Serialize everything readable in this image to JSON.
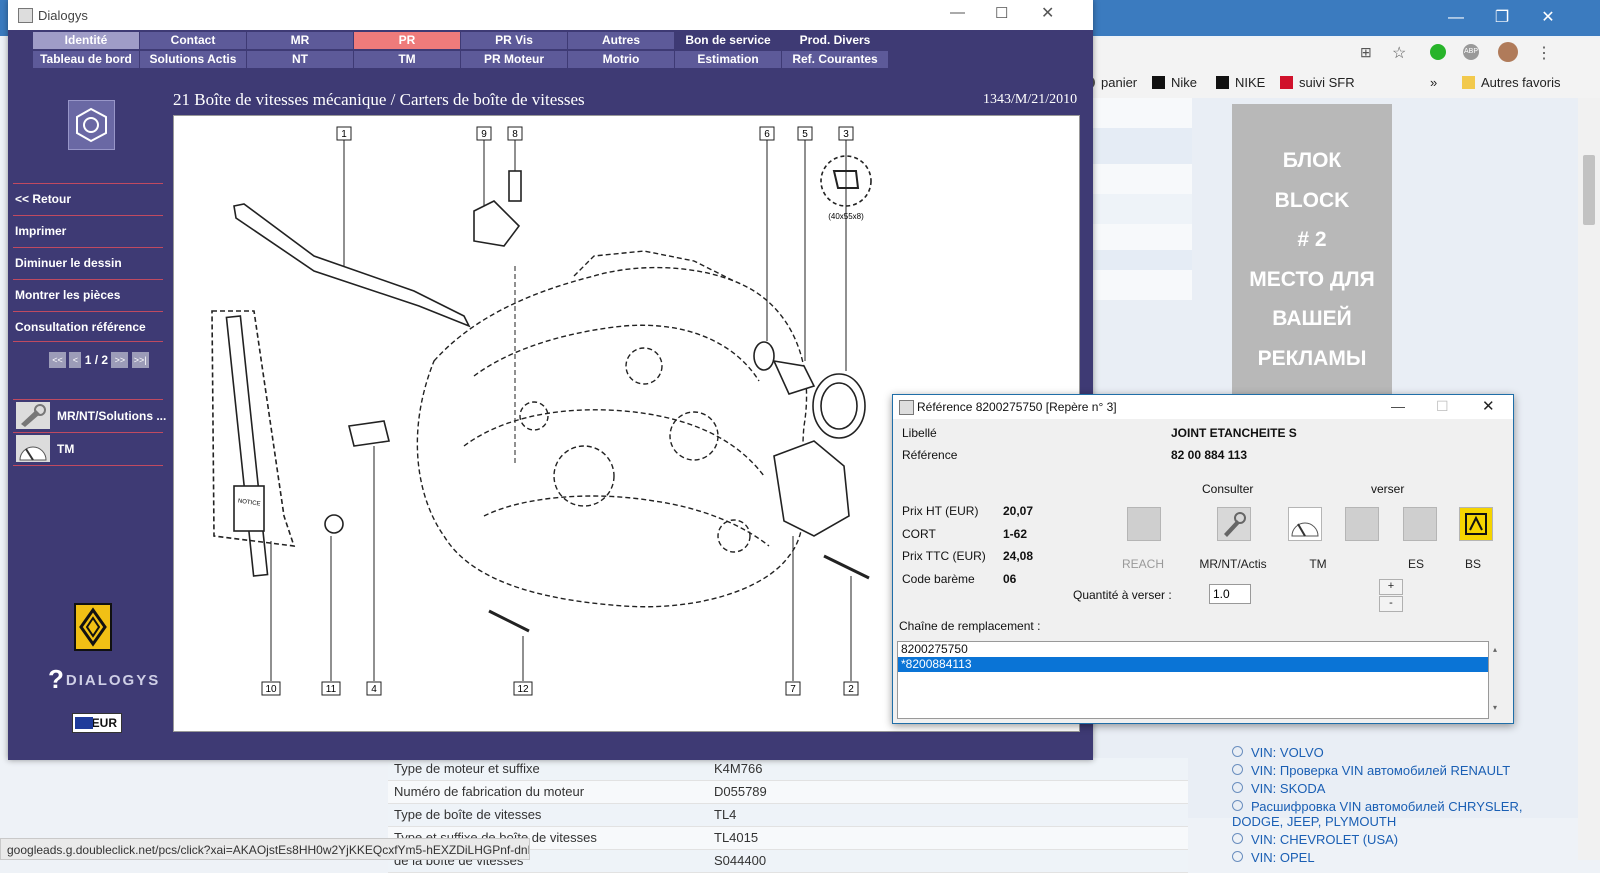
{
  "browser": {
    "bookmarks": [
      "panier",
      "Nike",
      "NIKE",
      "suivi SFR"
    ],
    "more_label": "»",
    "other_bookmarks": "Autres favoris",
    "ad_lines": [
      "БЛОК",
      "BLOCK",
      "# 2",
      "МЕСТО ДЛЯ",
      "ВАШЕЙ",
      "РЕКЛАМЫ"
    ],
    "side_links": [
      "VIN: VOLVO",
      "VIN: Проверка VIN автомобилей RENAULT",
      "VIN: SKODA",
      "Расшифровка VIN автомобилей CHRYSLER, DODGE, JEEP, PLYMOUTH",
      "VIN: CHEVROLET (USA)",
      "VIN: OPEL"
    ],
    "table": [
      {
        "k": "Type de moteur et suffixe",
        "v": "K4M766"
      },
      {
        "k": "Numéro de fabrication du moteur",
        "v": "D055789"
      },
      {
        "k": "Type de boîte de vitesses",
        "v": "TL4"
      },
      {
        "k": "Type et suffixe de boîte de vitesses",
        "v": "TL4015"
      },
      {
        "k": "de la boîte de vitesses",
        "v": "S044400"
      }
    ],
    "status_url": "googleads.g.doubleclick.net/pcs/click?xai=AKAOjstEs8HH0w2YjKKEQcxfYm5-hEXZDiLHGPnf-dnN..."
  },
  "window": {
    "title": "Dialogys",
    "menu": [
      [
        "Identité",
        "Contact",
        "MR",
        "PR",
        "PR Vis",
        "Autres",
        "Bon de service",
        "Prod. Divers"
      ],
      [
        "Tableau de bord",
        "Solutions Actis",
        "NT",
        "TM",
        "PR Moteur",
        "Motrio",
        "Estimation",
        "Ref. Courantes"
      ]
    ],
    "active_menu": "PR",
    "section_title": "21 Boîte de vitesses mécanique / Carters de boîte de vitesses",
    "section_ref": "1343/M/21/2010",
    "sidebar_buttons": [
      "<< Retour",
      "Imprimer",
      "Diminuer le dessin",
      "Montrer les pièces",
      "Consultation référence"
    ],
    "pager": {
      "text": "1 / 2",
      "prev_first": "<<",
      "prev": "<",
      "next": ">>",
      "last": ">>|"
    },
    "docs": [
      {
        "label": "MR/NT/Solutions ...",
        "icon": "wrench-doc-icon"
      },
      {
        "label": "TM",
        "icon": "clock-doc-icon"
      }
    ],
    "brand": "DIALOGYS",
    "currency": "EUR"
  },
  "drawing": {
    "callouts": [
      "1",
      "9",
      "8",
      "6",
      "5",
      "3",
      "10",
      "11",
      "4",
      "12",
      "7",
      "2"
    ],
    "seal_size": "(40x55x8)",
    "notice_label": "NOTICE"
  },
  "reference_dialog": {
    "title": "Référence 8200275750 [Repère n° 3]",
    "libelle_label": "Libellé",
    "libelle_value": "JOINT ETANCHEITE S",
    "reference_label": "Référence",
    "reference_value": "82 00 884 113",
    "consulter_label": "Consulter",
    "verser_label": "verser",
    "prices": [
      {
        "label": "Prix HT (EUR)",
        "value": "20,07"
      },
      {
        "label": "CORT",
        "value": "1-62"
      },
      {
        "label": "Prix TTC (EUR)",
        "value": "24,08"
      },
      {
        "label": "Code barème",
        "value": "06"
      }
    ],
    "icon_captions": [
      "REACH",
      "MR/NT/Actis",
      "TM",
      "",
      "ES",
      "BS"
    ],
    "quantity_label": "Quantité à verser :",
    "quantity_value": "1.0",
    "plus": "+",
    "minus": "-",
    "chain_label": "Chaîne de remplacement :",
    "chain_items": [
      "8200275750",
      "*8200884113"
    ],
    "selected_chain_index": 1
  }
}
